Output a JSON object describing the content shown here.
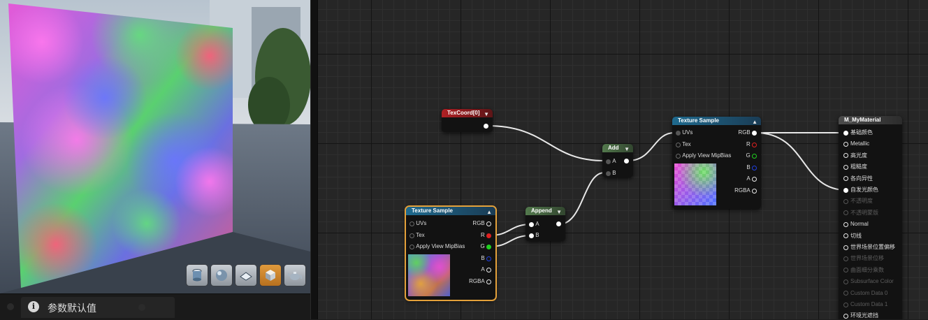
{
  "viewport": {
    "toolbar": [
      "cylinder-icon",
      "sphere-icon",
      "plane-icon",
      "cube-icon",
      "teapot-icon"
    ],
    "active_tool": "cube-icon"
  },
  "details": {
    "tab_label": "参数默认值"
  },
  "colors": {
    "selection": "#e4a13a",
    "header_blue": "#1f6a8e",
    "header_red": "#b02024",
    "header_green": "#53794d"
  },
  "nodes": {
    "texcoord": {
      "title": "TexCoord[0]"
    },
    "add": {
      "title": "Add",
      "in_a": "A",
      "in_b": "B"
    },
    "append": {
      "title": "Append",
      "in_a": "A",
      "in_b": "B"
    },
    "tex_sample_top": {
      "title": "Texture Sample",
      "uvs": "UVs",
      "tex": "Tex",
      "mip": "Apply View MipBias",
      "rgb": "RGB",
      "r": "R",
      "g": "G",
      "b": "B",
      "a": "A",
      "rgba": "RGBA"
    },
    "tex_sample_bottom": {
      "title": "Texture Sample",
      "uvs": "UVs",
      "tex": "Tex",
      "mip": "Apply View MipBias",
      "rgb": "RGB",
      "r": "R",
      "g": "G",
      "b": "B",
      "a": "A",
      "rgba": "RGBA"
    },
    "material": {
      "title": "M_MyMaterial",
      "pins": [
        "基础颜色",
        "Metallic",
        "高光度",
        "粗糙度",
        "各向异性",
        "自发光颜色",
        "不透明度",
        "不透明蒙版",
        "Normal",
        "切线",
        "世界场景位置偏移",
        "世界场景位移",
        "曲面细分乘数",
        "Subsurface Color",
        "Custom Data 0",
        "Custom Data 1",
        "环境光遮挡"
      ]
    }
  }
}
